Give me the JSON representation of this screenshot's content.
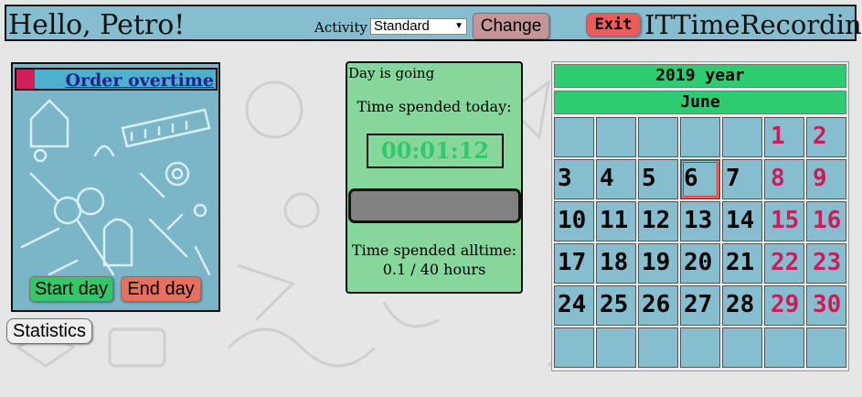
{
  "header": {
    "greeting": "Hello, Petro!",
    "activity_label": "Activity",
    "activity_selected": "Standard",
    "change_label": "Change",
    "exit_label": "Exit",
    "app_title": "ITTimeRecording"
  },
  "tools": {
    "overtime_link": "Order overtime",
    "start_label": "Start day",
    "end_label": "End day",
    "statistics_label": "Statistics"
  },
  "day": {
    "status": "Day is going",
    "today_label": "Time spended today:",
    "timer": "00:01:12",
    "progress_fraction": 0,
    "alltime_label": "Time spended alltime:",
    "alltime_value": "0.1 / 40 hours"
  },
  "calendar": {
    "year_label": "2019 year",
    "month_label": "June",
    "weeks": [
      [
        "",
        "",
        "",
        "",
        "",
        "1",
        "2"
      ],
      [
        "3",
        "4",
        "5",
        "6",
        "7",
        "8",
        "9"
      ],
      [
        "10",
        "11",
        "12",
        "13",
        "14",
        "15",
        "16"
      ],
      [
        "17",
        "18",
        "19",
        "20",
        "21",
        "22",
        "23"
      ],
      [
        "24",
        "25",
        "26",
        "27",
        "28",
        "29",
        "30"
      ],
      [
        "",
        "",
        "",
        "",
        "",
        "",
        ""
      ]
    ],
    "today": "6",
    "weekend_color": "#cc1c5a"
  },
  "colors": {
    "header_bg": "#86bed0",
    "calendar_header": "#2ecc71",
    "day_panel": "#87d69c",
    "timer_text": "#32c96c"
  }
}
